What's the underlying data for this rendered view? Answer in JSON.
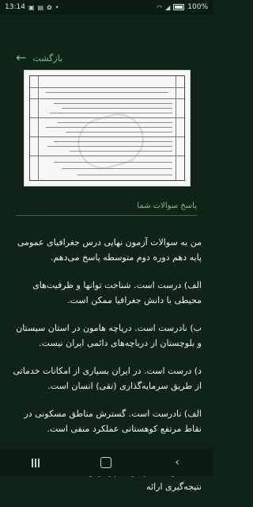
{
  "status_bar": {
    "time": "13:14",
    "battery": "100%"
  },
  "toolbar": {
    "back_label": "بازگشت"
  },
  "section": {
    "title": "پاسخ سوالات شما"
  },
  "answers": [
    "من به سوالات آزمون نهایی درس جغرافیای عمومی پایه دهم دوره دوم متوسطه پاسخ می‌دهم.",
    "الف) درست است. شناخت توانها و ظرفیت‌های محیطی با دانش جغرافیا ممکن است.",
    "ب) نادرست است. دریاچه هامون در استان سیستان و بلوچستان از دریاچه‌های دائمی ایران نیست.",
    "د) درست است. در ایران بسیاری از امکانات خدماتی از طریق سرمایه‌گذاری (تقی) انسان است.",
    "الف) نادرست است. گسترش مناطق مسکونی در نقاط مرتفع کوهستانی عملکرد منفی است.",
    "ب) درست است. تجزیه و تحلیل رات جمعیت شاغل یک سکونتگاه در مرحله پردازش اطلاعات - نتیجه‌گیری ارائه"
  ]
}
